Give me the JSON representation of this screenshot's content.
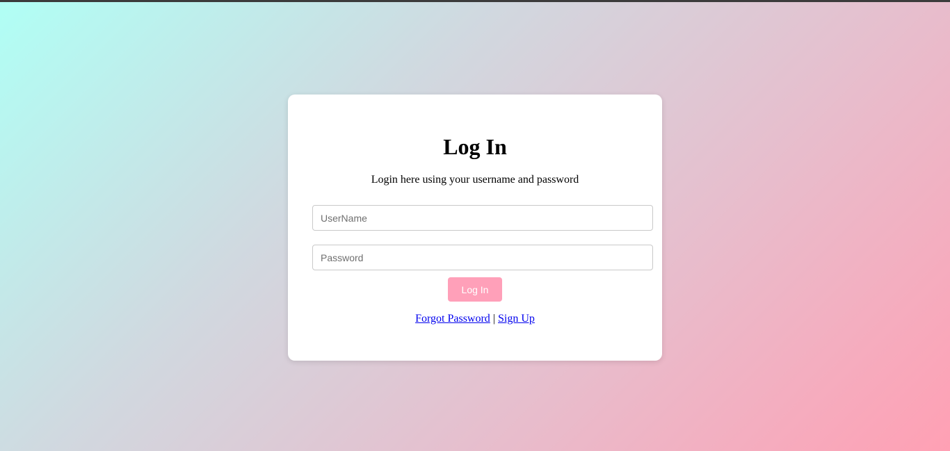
{
  "card": {
    "title": "Log In",
    "subtitle": "Login here using your username and password"
  },
  "form": {
    "username_placeholder": "UserName",
    "username_value": "",
    "password_placeholder": "Password",
    "password_value": "",
    "submit_label": "Log In"
  },
  "links": {
    "forgot_password": "Forgot Password",
    "separator": "|",
    "sign_up": "Sign Up"
  },
  "colors": {
    "button": "#ffa0b9",
    "link": "#0000ee",
    "gradient_start": "#b0fff5",
    "gradient_end": "#ffa0b4"
  }
}
